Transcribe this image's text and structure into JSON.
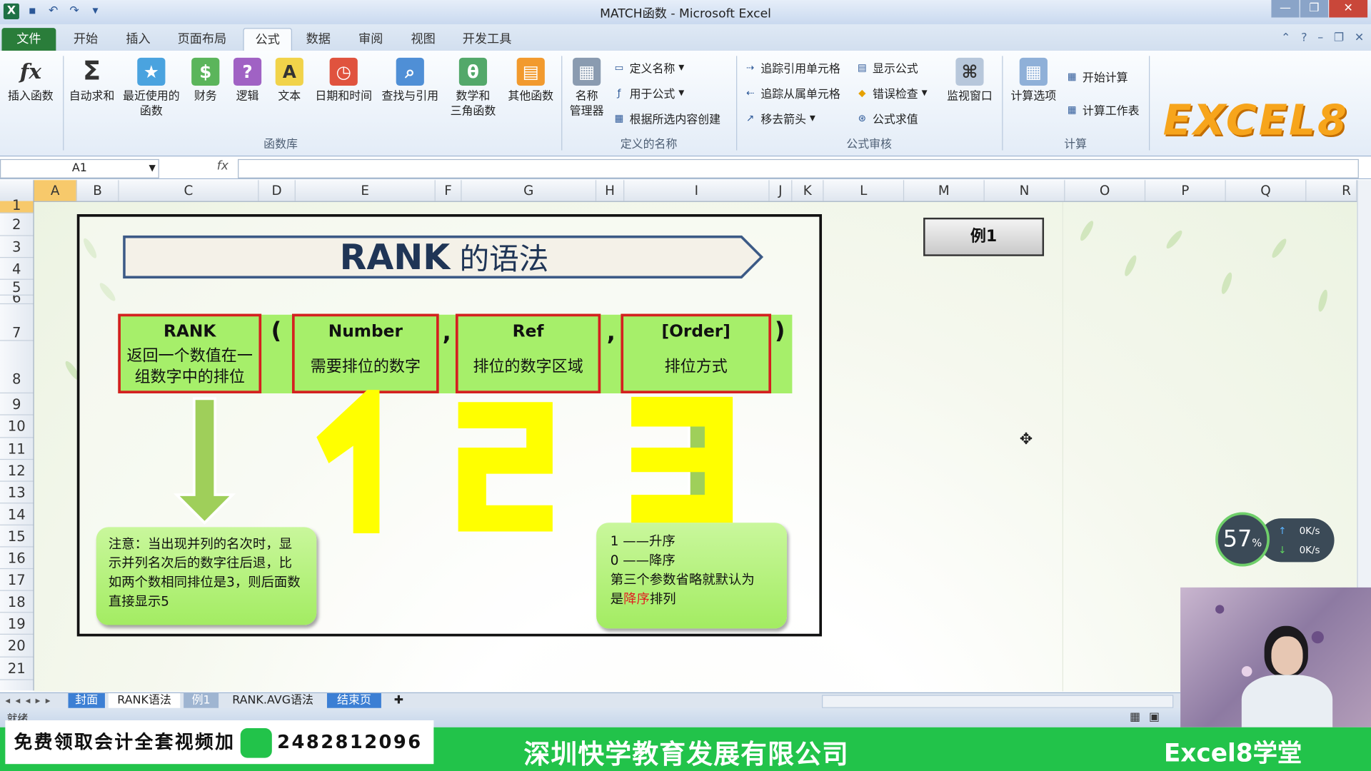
{
  "window": {
    "title": "MATCH函数 - Microsoft Excel"
  },
  "tabs": [
    "文件",
    "开始",
    "插入",
    "页面布局",
    "公式",
    "数据",
    "审阅",
    "视图",
    "开发工具"
  ],
  "ribbon": {
    "insert_function": "插入函数",
    "autosum": "自动求和",
    "recent_1": "最近使用的",
    "recent_2": "函数",
    "financial": "财务",
    "logical": "逻辑",
    "text": "文本",
    "datetime": "日期和时间",
    "lookup": "查找与引用",
    "math_1": "数学和",
    "math_2": "三角函数",
    "other": "其他函数",
    "group_library": "函数库",
    "name_mgr_1": "名称",
    "name_mgr_2": "管理器",
    "define_name": "定义名称",
    "use_in_formula": "用于公式",
    "create_from_sel": "根据所选内容创建",
    "group_names": "定义的名称",
    "trace_precedents": "追踪引用单元格",
    "trace_dependents": "追踪从属单元格",
    "remove_arrows": "移去箭头",
    "show_formulas": "显示公式",
    "error_checking": "错误检查",
    "evaluate": "公式求值",
    "watch_window": "监视窗口",
    "group_audit": "公式审核",
    "calc_options": "计算选项",
    "calc_now": "开始计算",
    "calc_sheet": "计算工作表",
    "group_calc": "计算",
    "logo": "EXCEL8"
  },
  "formula_bar": {
    "name_box": "A1",
    "fx": "fx",
    "value": ""
  },
  "columns": [
    "A",
    "B",
    "C",
    "D",
    "E",
    "F",
    "G",
    "H",
    "I",
    "J",
    "K",
    "L",
    "M",
    "N",
    "O",
    "P",
    "Q",
    "R"
  ],
  "rows": [
    "1",
    "2",
    "3",
    "4",
    "5",
    "6",
    "7",
    "8",
    "9",
    "10",
    "11",
    "12",
    "13",
    "14",
    "15",
    "16",
    "17",
    "18",
    "19",
    "20",
    "21"
  ],
  "slide": {
    "title_main": "RANK",
    "title_rest": " 的语法",
    "open_paren": "(",
    "comma": ",",
    "close_paren": ")",
    "boxes": [
      {
        "head": "RANK",
        "desc": "返回一个数值在一组数字中的排位"
      },
      {
        "head": "Number",
        "desc": "需要排位的数字"
      },
      {
        "head": "Ref",
        "desc": "排位的数字区域"
      },
      {
        "head": "[Order]",
        "desc": "排位方式"
      }
    ],
    "big_numbers": [
      "1",
      "2",
      "3"
    ],
    "note_left": "注意：当出现并列的名次时，显示并列名次后的数字往后退，比如两个数相同排位是3，则后面数直接显示5",
    "note_right_l1": "1 ——升序",
    "note_right_l2": "0 ——降序",
    "note_right_l3a": "第三个参数省略就默认为",
    "note_right_l3b": "是",
    "note_right_red": "降序",
    "note_right_l3c": "排列"
  },
  "example_button": "例1",
  "speed": {
    "percent": "57",
    "unit": "%",
    "up": "0K/s",
    "down": "0K/s"
  },
  "sheet_tabs": [
    "封面",
    "RANK语法",
    "例1",
    "RANK.AVG语法",
    "结束页"
  ],
  "status": {
    "ready": "就绪"
  },
  "promo": {
    "left": "免费领取会计全套视频加",
    "phone": "2482812096",
    "center": "深圳快学教育发展有限公司",
    "right": "Excel8学堂"
  },
  "colors": {
    "green_box": "#a6ef6a",
    "red_border": "#d42020",
    "yellow": "#ffff00",
    "promo_green": "#22c34a",
    "title_navy": "#1f3556"
  }
}
